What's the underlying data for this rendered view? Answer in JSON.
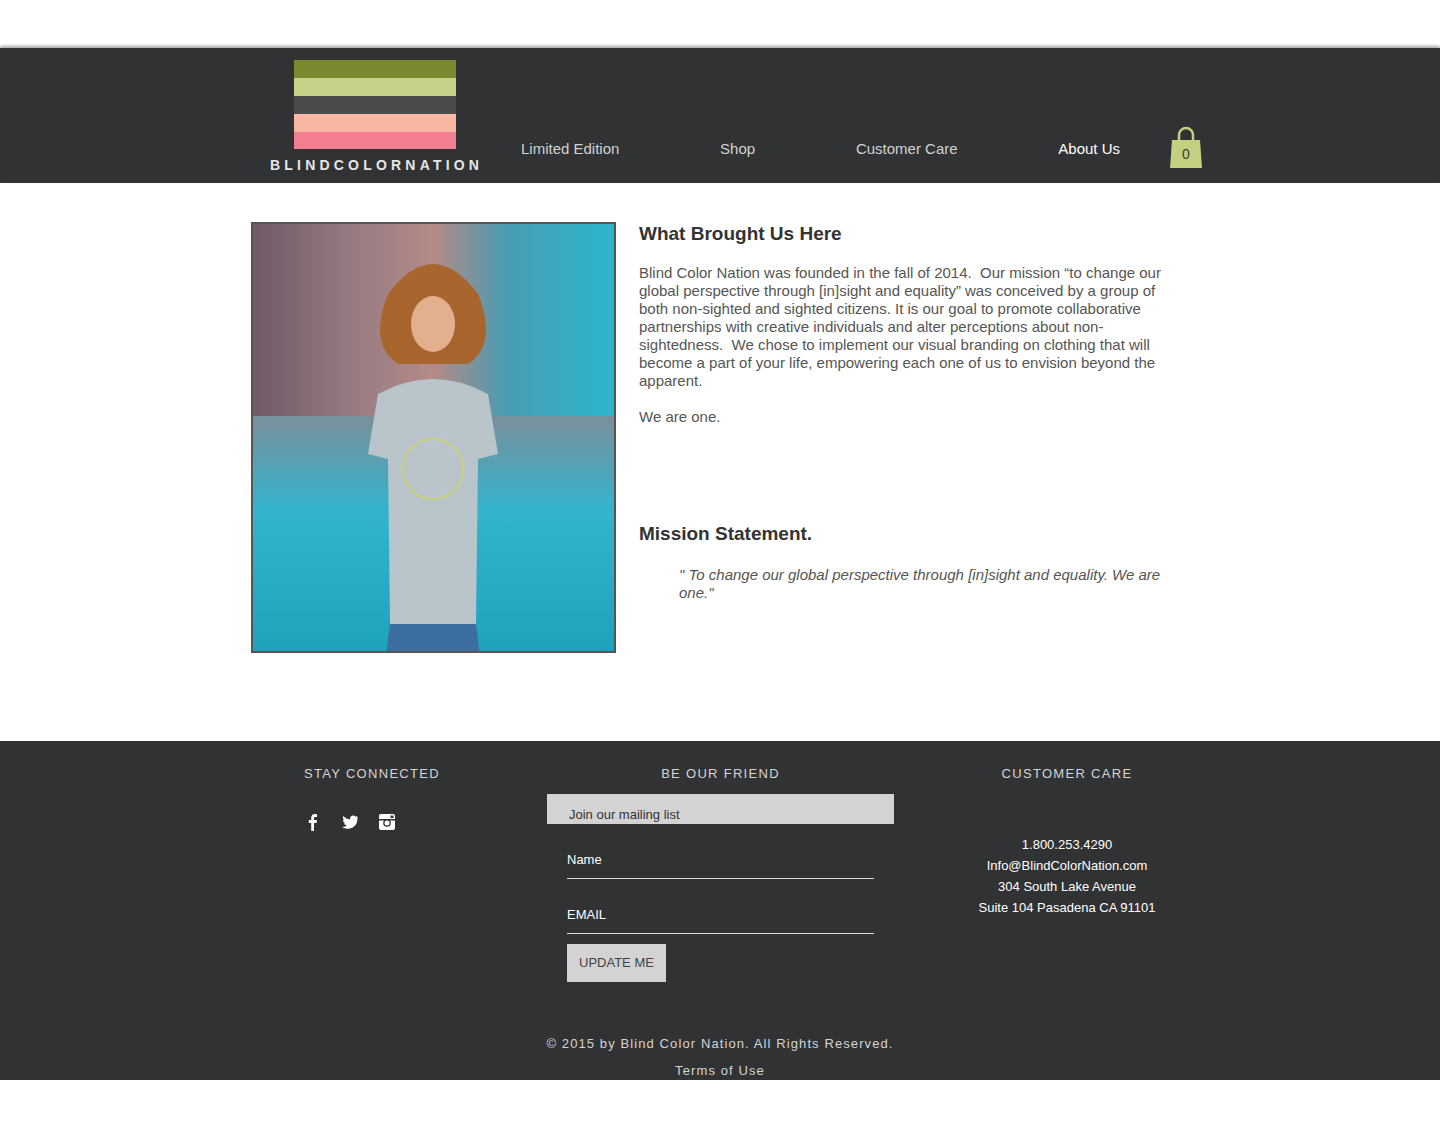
{
  "brand": {
    "name": "BLINDCOLORNATION"
  },
  "nav": [
    {
      "label": "Limited Edition",
      "selected": false
    },
    {
      "label": "Shop",
      "selected": false
    },
    {
      "label": "Customer Care",
      "selected": false
    },
    {
      "label": "About Us",
      "selected": true
    }
  ],
  "cart": {
    "count": "0"
  },
  "about": {
    "heading": "What Brought Us Here",
    "paragraphs": [
      "Blind Color Nation was founded in the fall of 2014.  Our mission “to change our global perspective through [in]sight and equality” was conceived by a group of both non-sighted and sighted citizens. It is our goal to promote collaborative partnerships with creative individuals and alter perceptions about non-sightedness.  We chose to implement our visual branding on clothing that will become a part of your life, empowering each one of us to envision beyond the apparent.",
      "We are one."
    ]
  },
  "mission": {
    "heading": "Mission Statement.",
    "quote": "\" To change our global perspective through [in]sight and equality. We are one.\""
  },
  "footer": {
    "connected": {
      "title": "STAY CONNECTED"
    },
    "friend": {
      "title": "BE OUR FRIEND",
      "banner": "Join our mailing list",
      "fields": [
        "Name",
        "EMAIL"
      ],
      "button": "UPDATE ME"
    },
    "care": {
      "title": "CUSTOMER CARE",
      "lines": [
        "1.800.253.4290",
        "Info@BlindColorNation.com",
        "304 South Lake Avenue",
        "Suite 104 Pasadena CA 91101"
      ]
    },
    "copyright": "© 2015 by Blind Color Nation. All Rights Reserved.",
    "terms": "Terms of Use"
  }
}
